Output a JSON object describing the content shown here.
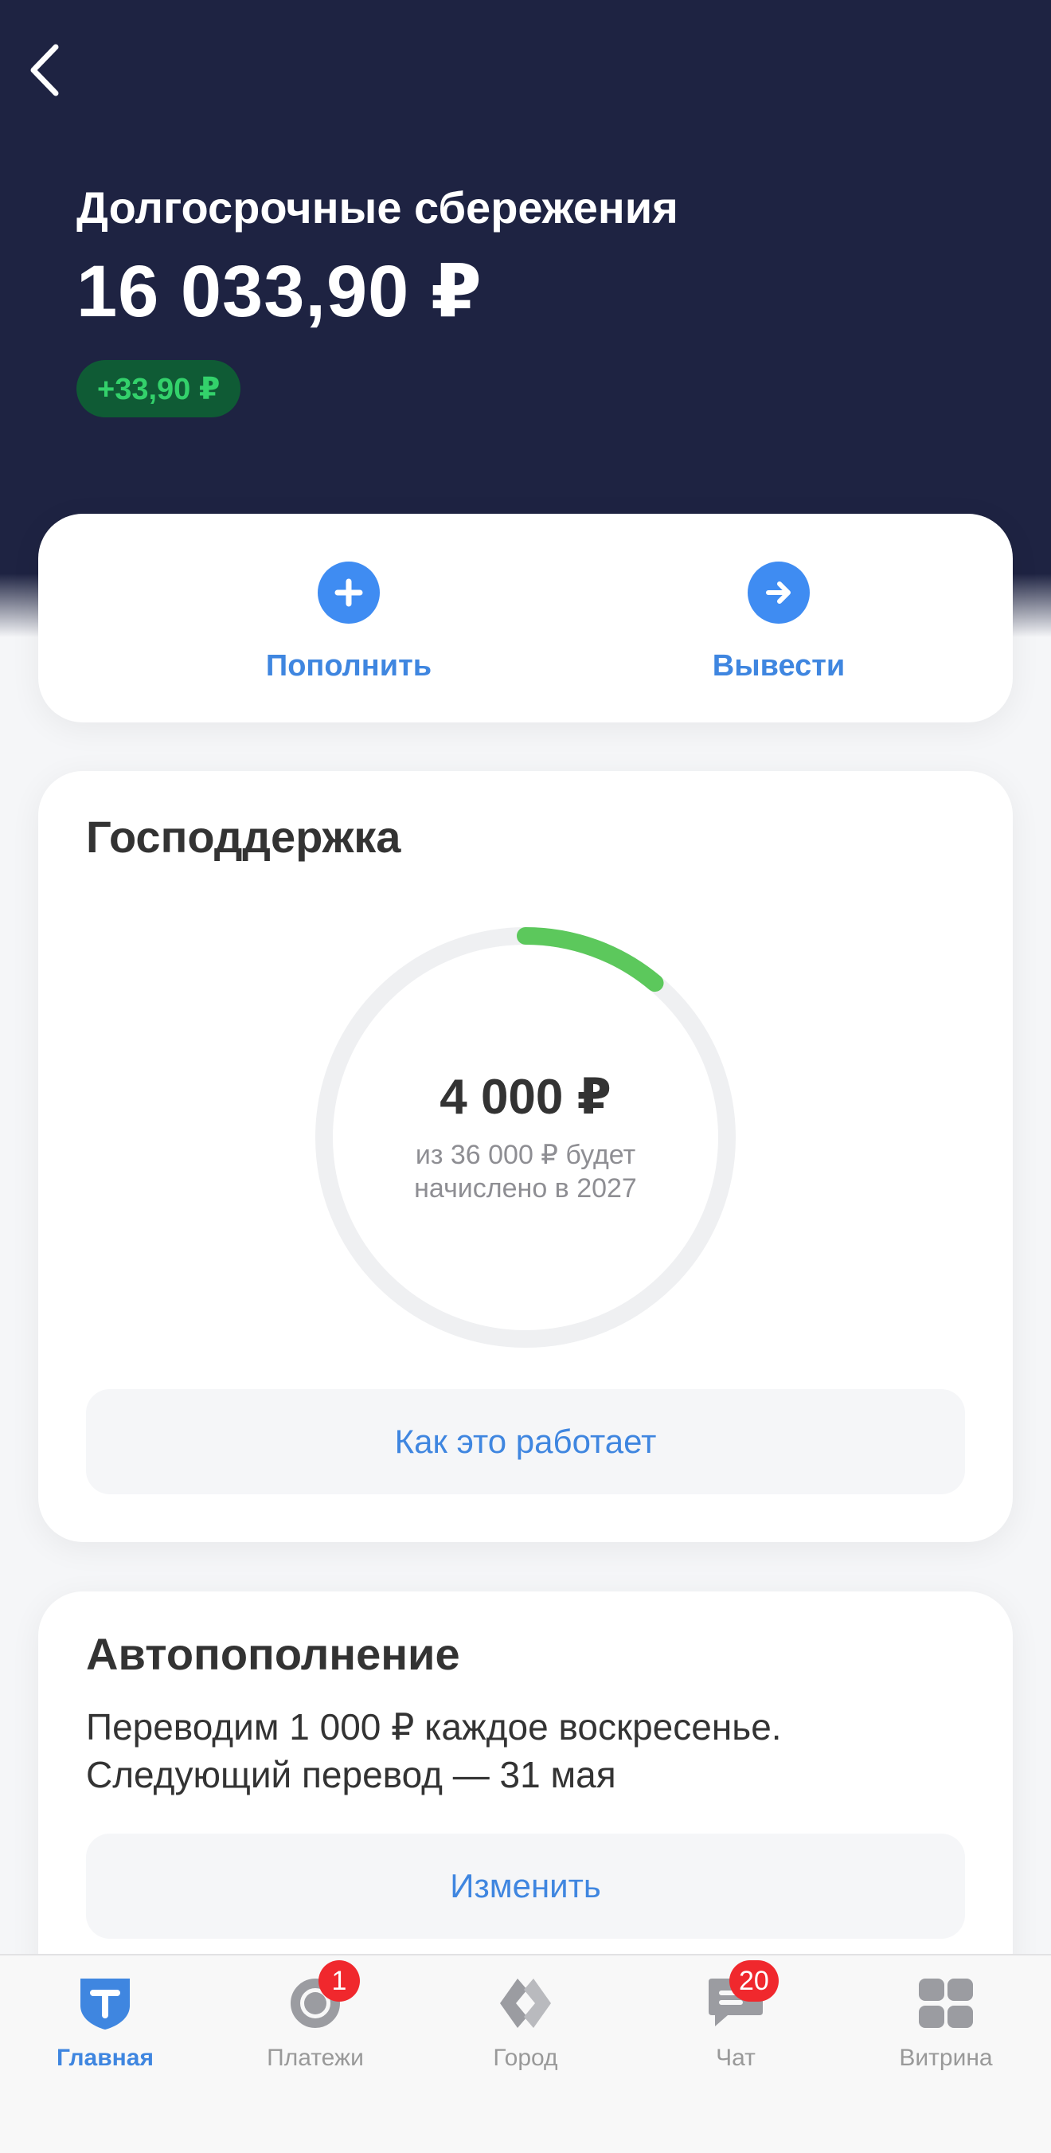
{
  "header": {
    "title": "Долгосрочные сбережения",
    "amount": "16 033,90 ₽",
    "delta": "+33,90 ₽"
  },
  "actions": {
    "topup_label": "Пополнить",
    "withdraw_label": "Вывести"
  },
  "support": {
    "title": "Господдержка",
    "amount": "4 000 ₽",
    "caption_line1": "из 36 000 ₽ будет",
    "caption_line2": "начислено в 2027",
    "progress": 0.111,
    "how_label": "Как это работает"
  },
  "autotopup": {
    "title": "Автопополнение",
    "line1": "Переводим 1 000 ₽ каждое воскресенье.",
    "line2": "Следующий перевод — 31 мая",
    "edit_label": "Изменить"
  },
  "tabbar": {
    "tabs": [
      {
        "label": "Главная",
        "icon": "home-shield-icon",
        "active": true
      },
      {
        "label": "Платежи",
        "icon": "payments-icon",
        "badge": "1"
      },
      {
        "label": "Город",
        "icon": "city-icon"
      },
      {
        "label": "Чат",
        "icon": "chat-icon",
        "badge": "20"
      },
      {
        "label": "Витрина",
        "icon": "showcase-icon"
      }
    ]
  },
  "colors": {
    "header_bg": "#1e2342",
    "accent": "#3f86e0",
    "positive": "#33d16b",
    "progress": "#5cc85c",
    "badge": "#f0282d"
  }
}
